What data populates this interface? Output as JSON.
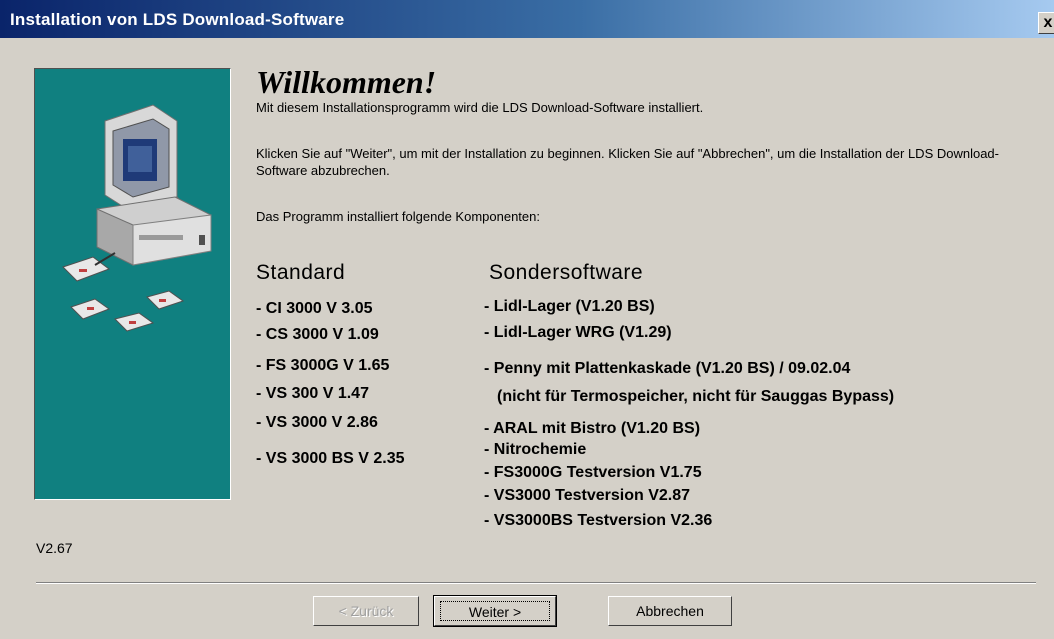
{
  "window": {
    "title": "Installation von LDS Download-Software",
    "close_label": "x"
  },
  "heading": "Willkommen!",
  "intro": "Mit diesem Installationsprogramm wird die LDS Download-Software installiert.",
  "instruction": "Klicken Sie auf \"Weiter\", um mit der Installation zu beginnen. Klicken Sie auf \"Abbrechen\", um die Installation der LDS Download-Software abzubrechen.",
  "components_intro": "Das Programm installiert folgende Komponenten:",
  "standard": {
    "heading": "Standard",
    "items": [
      "- CI 3000 V 3.05",
      "- CS 3000 V 1.09",
      "- FS 3000G V 1.65",
      "- VS 300 V 1.47",
      "- VS 3000 V 2.86",
      "- VS 3000 BS V 2.35"
    ]
  },
  "sondersoftware": {
    "heading": "Sondersoftware",
    "items": [
      "- Lidl-Lager (V1.20 BS)",
      "- Lidl-Lager WRG (V1.29)",
      "- Penny mit Plattenkaskade (V1.20 BS) / 09.02.04",
      "(nicht für Termospeicher, nicht für Sauggas Bypass)",
      "- ARAL mit Bistro (V1.20 BS)",
      "- Nitrochemie",
      "- FS3000G Testversion V1.75",
      "- VS3000 Testversion V2.87",
      "- VS3000BS Testversion V2.36"
    ]
  },
  "version": "V2.67",
  "buttons": {
    "back": "< Zurück",
    "next": "Weiter >",
    "cancel": "Abbrechen"
  },
  "icons": {
    "illustration": "computer-with-disks-icon",
    "close": "close-icon"
  },
  "colors": {
    "title_bar": "#0a246a",
    "panel": "#108080",
    "dialog": "#d4d0c8"
  }
}
